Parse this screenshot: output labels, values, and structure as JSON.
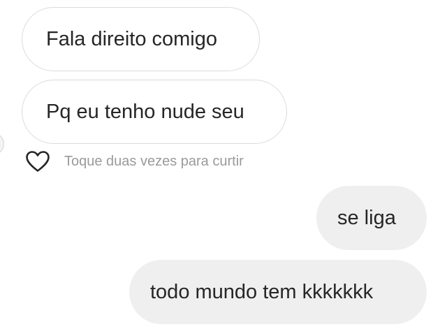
{
  "conversation": {
    "messages": [
      {
        "direction": "received",
        "text": "Fala direito comigo"
      },
      {
        "direction": "received",
        "text": "Pq eu tenho nude seu"
      },
      {
        "direction": "sent",
        "text": "se liga"
      },
      {
        "direction": "sent",
        "text": "todo mundo tem kkkkkkk"
      }
    ],
    "like_hint": "Toque duas vezes para curtir",
    "like_icon": "heart-outline-icon"
  }
}
